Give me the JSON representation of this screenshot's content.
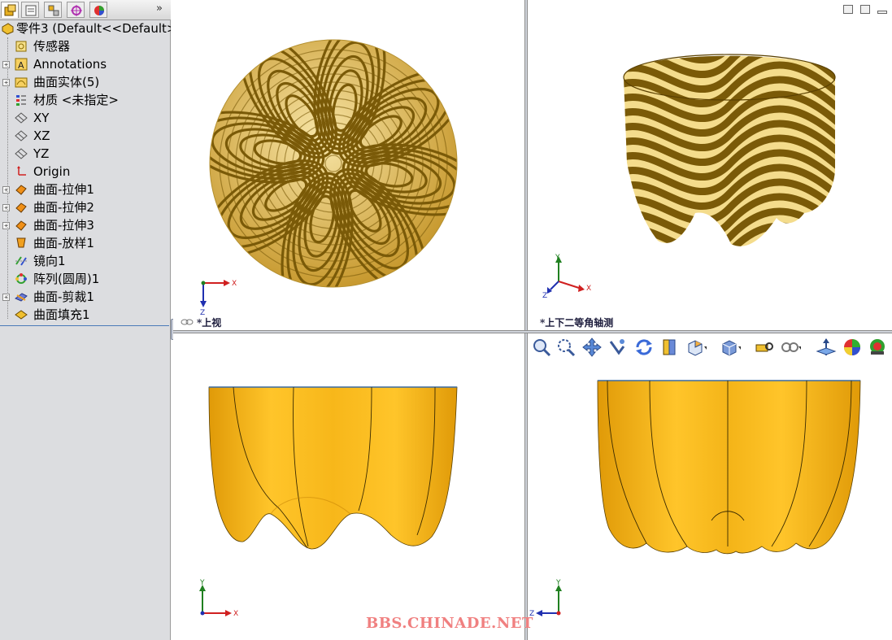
{
  "tree": {
    "root_label": "零件3 (Default<<Default>",
    "items": [
      {
        "label": "传感器",
        "icon": "sensor-icon",
        "expandable": false
      },
      {
        "label": "Annotations",
        "icon": "annotations-icon",
        "expandable": true
      },
      {
        "label": "曲面实体(5)",
        "icon": "surface-bodies-icon",
        "expandable": true
      },
      {
        "label": "材质 <未指定>",
        "icon": "material-icon",
        "expandable": false
      },
      {
        "label": "XY",
        "icon": "plane-icon",
        "expandable": false
      },
      {
        "label": "XZ",
        "icon": "plane-icon",
        "expandable": false
      },
      {
        "label": "YZ",
        "icon": "plane-icon",
        "expandable": false
      },
      {
        "label": "Origin",
        "icon": "origin-icon",
        "expandable": false
      },
      {
        "label": "曲面-拉伸1",
        "icon": "surface-extrude-icon",
        "expandable": true
      },
      {
        "label": "曲面-拉伸2",
        "icon": "surface-extrude-icon",
        "expandable": true
      },
      {
        "label": "曲面-拉伸3",
        "icon": "surface-extrude-icon",
        "expandable": true
      },
      {
        "label": "曲面-放样1",
        "icon": "surface-loft-icon",
        "expandable": false
      },
      {
        "label": "镜向1",
        "icon": "mirror-icon",
        "expandable": false
      },
      {
        "label": "阵列(圆周)1",
        "icon": "circular-pattern-icon",
        "expandable": false
      },
      {
        "label": "曲面-剪裁1",
        "icon": "surface-trim-icon",
        "expandable": true
      },
      {
        "label": "曲面填充1",
        "icon": "surface-fill-icon",
        "expandable": false
      }
    ]
  },
  "viewports": {
    "top_label": "*上视",
    "iso_label": "*上下二等角轴测"
  },
  "triad": {
    "x": "X",
    "y": "Y",
    "z": "Z"
  },
  "watermark": "BBS.CHINADE.NET",
  "colors": {
    "model_yellow": "#f7b71a",
    "zebra_dark": "#7a5a08",
    "zebra_light": "#f4dc8c",
    "axis_x": "#d02020",
    "axis_y": "#208020",
    "axis_z": "#2030b0"
  }
}
